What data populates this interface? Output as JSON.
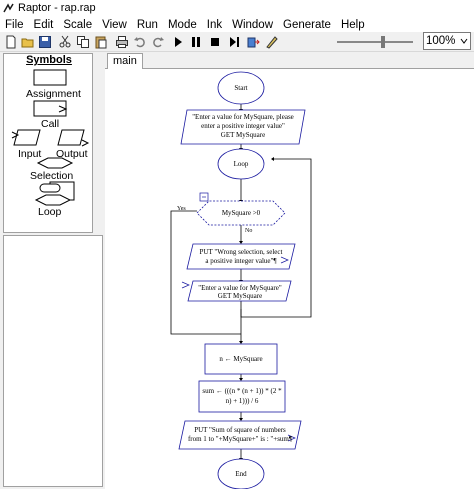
{
  "window": {
    "title": "Raptor - rap.rap"
  },
  "menu": [
    "File",
    "Edit",
    "Scale",
    "View",
    "Run",
    "Mode",
    "Ink",
    "Window",
    "Generate",
    "Help"
  ],
  "zoom": {
    "value": "100%"
  },
  "symbols": {
    "title": "Symbols",
    "assignment": "Assignment",
    "call": "Call",
    "input": "Input",
    "output": "Output",
    "selection": "Selection",
    "loop": "Loop"
  },
  "tabs": [
    "main"
  ],
  "flowchart": {
    "start": "Start",
    "prompt1_line1": "\"Enter a value for MySquare, please",
    "prompt1_line2": "enter a positive integer value\"",
    "prompt1_line3": "GET MySquare",
    "loop": "Loop",
    "yes": "Yes",
    "no": "No",
    "condition": "MySquare >0",
    "put_wrong_line1": "PUT \"Wrong selection, select",
    "put_wrong_line2": "a positive integer value\"¶",
    "prompt2_line1": "\"Enter a value for MySquare\"",
    "prompt2_line2": "GET MySquare",
    "assign_n": "n ← MySquare",
    "assign_sum_line1": "sum ← (((n * (n + 1)) * (2 *",
    "assign_sum_line2": "n) + 1))) / 6",
    "put_sum_line1": "PUT \"Sum of square of numbers",
    "put_sum_line2": "from 1 to \"+MySquare+\" is : \"+sum¶",
    "end": "End"
  }
}
